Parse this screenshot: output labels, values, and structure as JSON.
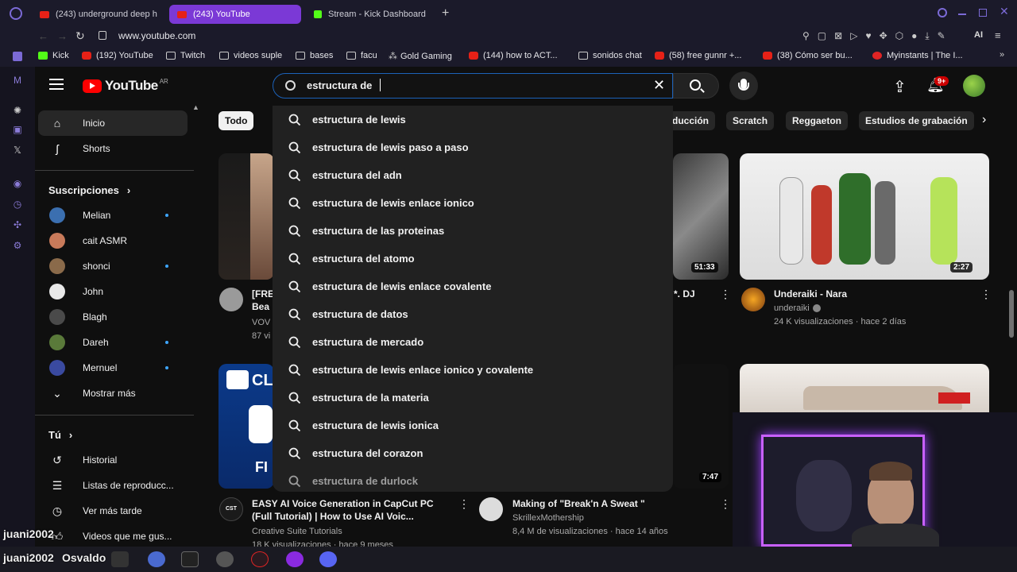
{
  "browser": {
    "tabs": [
      {
        "label": "(243) underground deep h",
        "active": false
      },
      {
        "label": "(243) YouTube",
        "active": true
      },
      {
        "label": "Stream - Kick Dashboard",
        "active": false
      }
    ],
    "url": "www.youtube.com",
    "ai_label": "AI",
    "bookmarks": [
      {
        "label": "Kick",
        "icon": "kick-icon"
      },
      {
        "label": "(192) YouTube",
        "icon": "youtube-icon"
      },
      {
        "label": "Twitch",
        "icon": "twitch-icon"
      },
      {
        "label": "videos suple",
        "icon": "folder-icon"
      },
      {
        "label": "bases",
        "icon": "folder-icon"
      },
      {
        "label": "facu",
        "icon": "folder-icon"
      },
      {
        "label": "Gold Gaming",
        "icon": "gold-gaming-icon"
      },
      {
        "label": "(144) how to ACT...",
        "icon": "youtube-icon"
      },
      {
        "label": "sonidos chat",
        "icon": "folder-icon"
      },
      {
        "label": "(58) free gunnr +...",
        "icon": "youtube-icon"
      },
      {
        "label": "(38) Cómo ser bu...",
        "icon": "youtube-icon"
      },
      {
        "label": "Myinstants | The I...",
        "icon": "myinstants-icon"
      }
    ]
  },
  "youtube": {
    "logo_text": "YouTube",
    "region": "AR",
    "search": {
      "value": "estructura de",
      "suggestions": [
        "estructura de lewis",
        "estructura de lewis paso a paso",
        "estructura del adn",
        "estructura de lewis enlace ionico",
        "estructura de las proteinas",
        "estructura del atomo",
        "estructura de lewis enlace covalente",
        "estructura de datos",
        "estructura de mercado",
        "estructura de lewis enlace ionico y covalente",
        "estructura de la materia",
        "estructura de lewis ionica",
        "estructura del corazon",
        "estructura de durlock"
      ]
    },
    "notifications_count": "9+",
    "chips": [
      "Todo",
      "ducción",
      "Scratch",
      "Reggaeton",
      "Estudios de grabación"
    ],
    "sidebar": {
      "main": [
        {
          "label": "Inicio",
          "icon": "home-icon"
        },
        {
          "label": "Shorts",
          "icon": "shorts-icon"
        }
      ],
      "subs_title": "Suscripciones",
      "subs": [
        {
          "label": "Melian",
          "dot": true,
          "color": "#3b6fb0"
        },
        {
          "label": "cait ASMR",
          "dot": false,
          "color": "#c87a5a"
        },
        {
          "label": "shonci",
          "dot": true,
          "color": "#8a6a4a"
        },
        {
          "label": "John",
          "dot": false,
          "color": "#e8e8e8"
        },
        {
          "label": "Blagh",
          "dot": false,
          "color": "#4a4a4a"
        },
        {
          "label": "Dareh",
          "dot": true,
          "color": "#5a7a3a"
        },
        {
          "label": "Mernuel",
          "dot": true,
          "color": "#3a4aa0"
        }
      ],
      "show_more": "Mostrar más",
      "you_title": "Tú",
      "you": [
        {
          "label": "Historial",
          "icon": "history-icon"
        },
        {
          "label": "Listas de reproducc...",
          "icon": "playlists-icon"
        },
        {
          "label": "Ver más tarde",
          "icon": "clock-icon"
        },
        {
          "label": "Videos que me gus...",
          "icon": "like-icon"
        }
      ]
    },
    "videos": [
      {
        "title_fragment": "[FRE",
        "title_fragment2": "Bea",
        "meta1": "VOV",
        "meta2": "87 vi"
      },
      {
        "duration": "51:33",
        "title_fragment": "*. DJ"
      },
      {
        "title": "Underaiki - Nara",
        "channel": "underaiki",
        "stats": "24 K visualizaciones · hace 2 días",
        "duration": "2:27"
      },
      {
        "title": "EASY AI Voice Generation in CapCut PC (Full Tutorial) | How to Use AI Voic...",
        "channel": "Creative Suite Tutorials",
        "stats": "18 K visualizaciones · hace 9 meses",
        "thumb_text": "CL",
        "thumb_text2": "FI"
      },
      {
        "title": "Making of \"Break'n A Sweat \"",
        "channel": "SkrillexMothership",
        "stats": "8,4 M de visualizaciones · hace 14 años",
        "duration": "7:47"
      }
    ]
  },
  "overlay": {
    "chat_users": [
      "juani2002",
      "juani2002",
      "Osvaldo"
    ]
  }
}
